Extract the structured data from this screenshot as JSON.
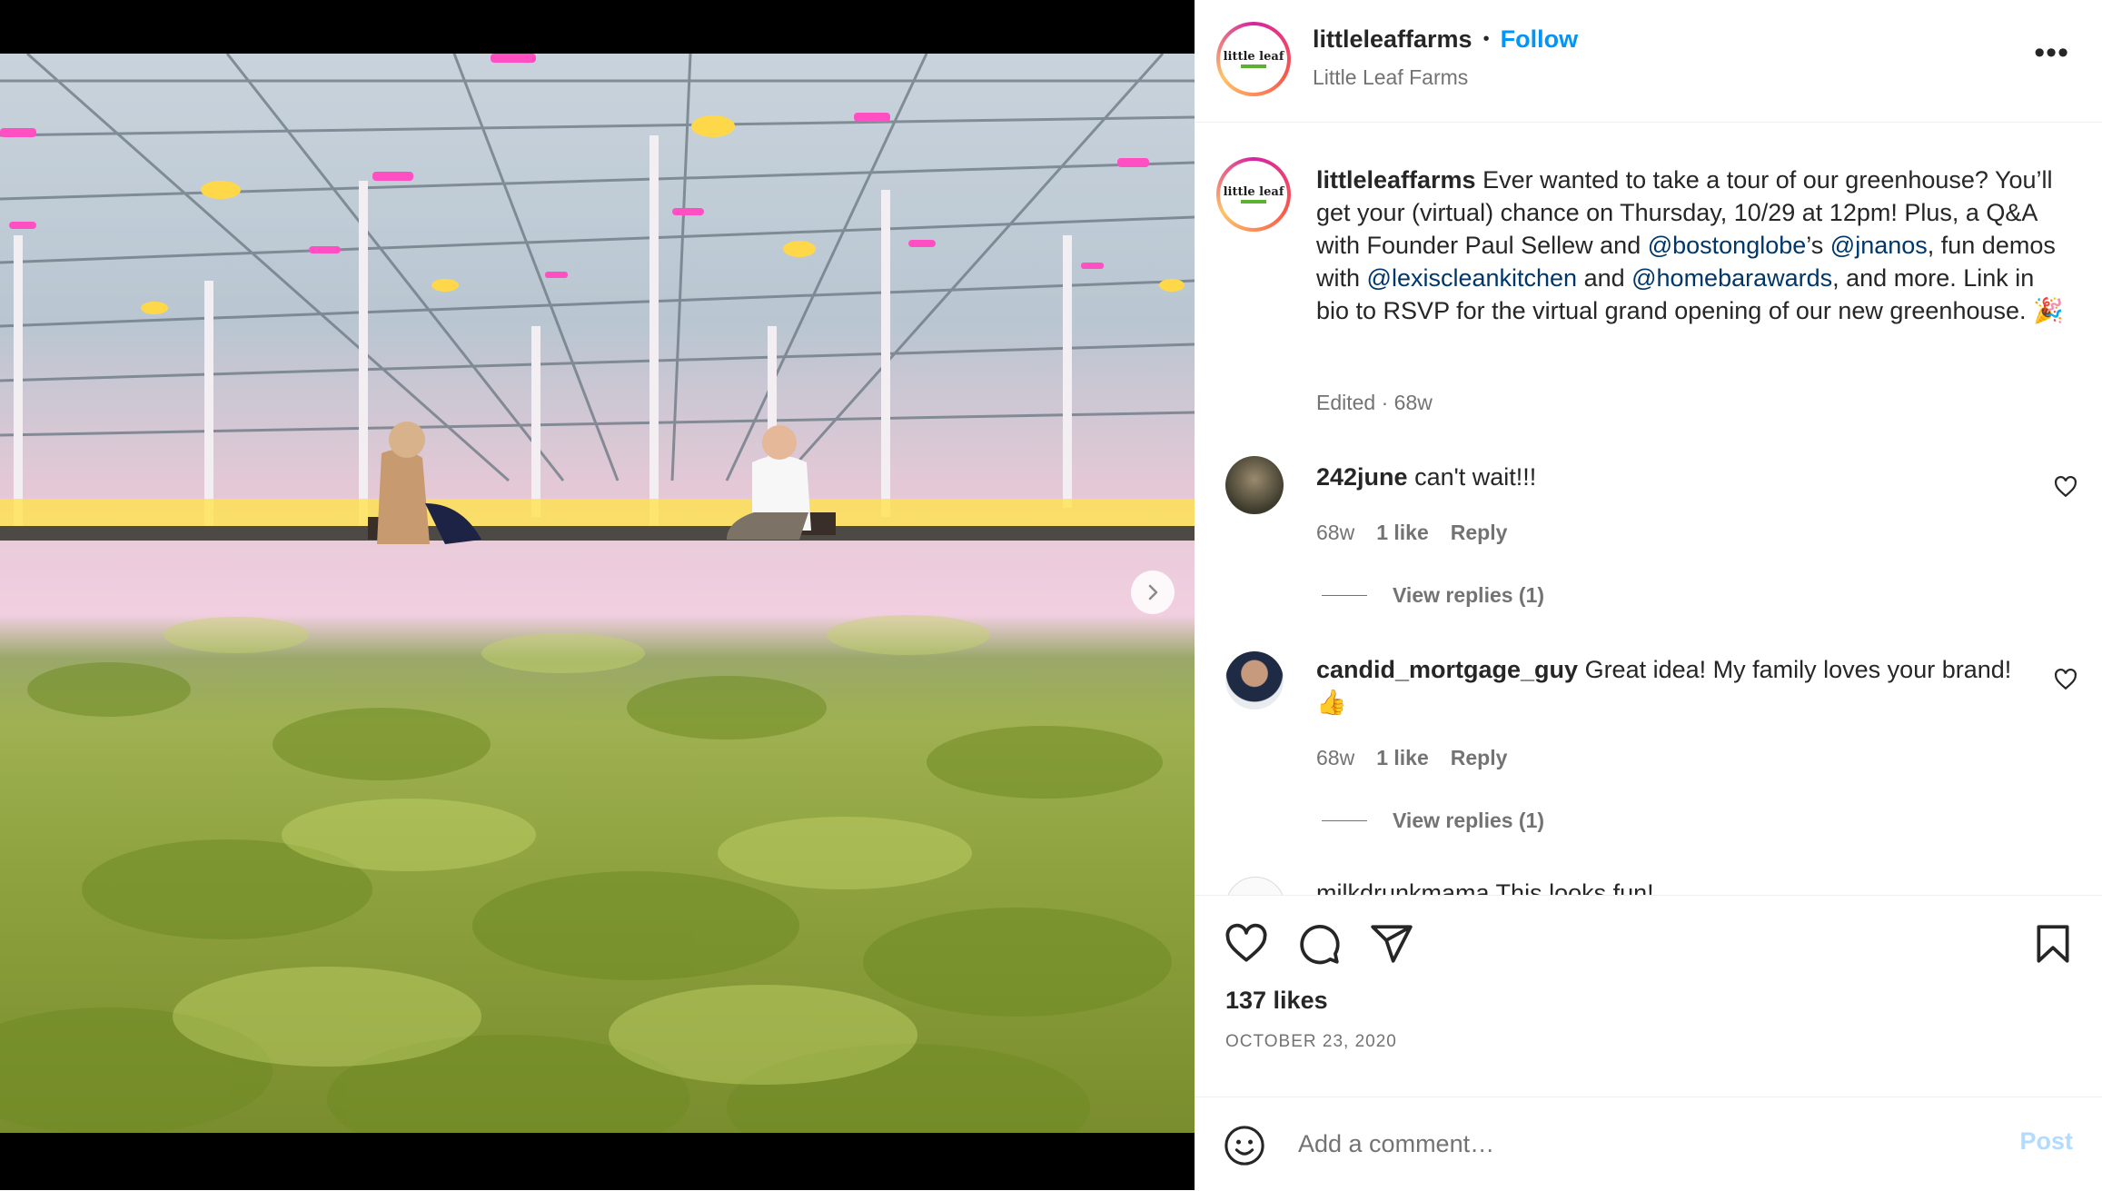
{
  "post": {
    "username": "littleleaffarms",
    "separator": "•",
    "follow_label": "Follow",
    "display_name": "Little Leaf Farms",
    "more_label": "•••",
    "avatar_logo_text": "little leaf",
    "caption": {
      "username": "littleleaffarms",
      "parts": [
        {
          "text": " Ever wanted to take a tour of our greenhouse? You’ll get your (virtual) chance on Thursday, 10/29 at 12pm! Plus, a Q&A with Founder Paul Sellew and ",
          "mention": false
        },
        {
          "text": "@bostonglobe",
          "mention": true
        },
        {
          "text": "’s ",
          "mention": false
        },
        {
          "text": "@jnanos",
          "mention": true
        },
        {
          "text": ", fun demos with ",
          "mention": false
        },
        {
          "text": "@lexiscleankitchen",
          "mention": true
        },
        {
          "text": " and ",
          "mention": false
        },
        {
          "text": "@homebarawards",
          "mention": true
        },
        {
          "text": ", and more. Link in bio to RSVP for the virtual grand opening of our new greenhouse. 🎉",
          "mention": false
        }
      ],
      "meta": "Edited · 68w"
    },
    "comments": [
      {
        "username": "242june",
        "text": " can't wait!!!",
        "time": "68w",
        "likes": "1 like",
        "reply": "Reply",
        "view_replies": "View replies (1)"
      },
      {
        "username": "candid_mortgage_guy",
        "text": " Great idea! My family loves your brand! 👍",
        "time": "68w",
        "likes": "1 like",
        "reply": "Reply",
        "view_replies": "View replies (1)"
      }
    ],
    "partial_comment": "milkdrunkmama This looks fun!",
    "likes": "137 likes",
    "date": "OCTOBER 23, 2020",
    "add_comment_placeholder": "Add a comment…",
    "post_label": "Post"
  },
  "colors": {
    "accent": "#0095f6",
    "mention": "#00376b",
    "muted": "#737373",
    "post_disabled": "#b3dbff"
  },
  "carousel": {
    "count": 2,
    "active": 1
  },
  "icons": [
    "heart-icon",
    "comment-icon",
    "share-icon",
    "bookmark-icon",
    "emoji-icon",
    "chevron-right-icon",
    "more-icon"
  ]
}
